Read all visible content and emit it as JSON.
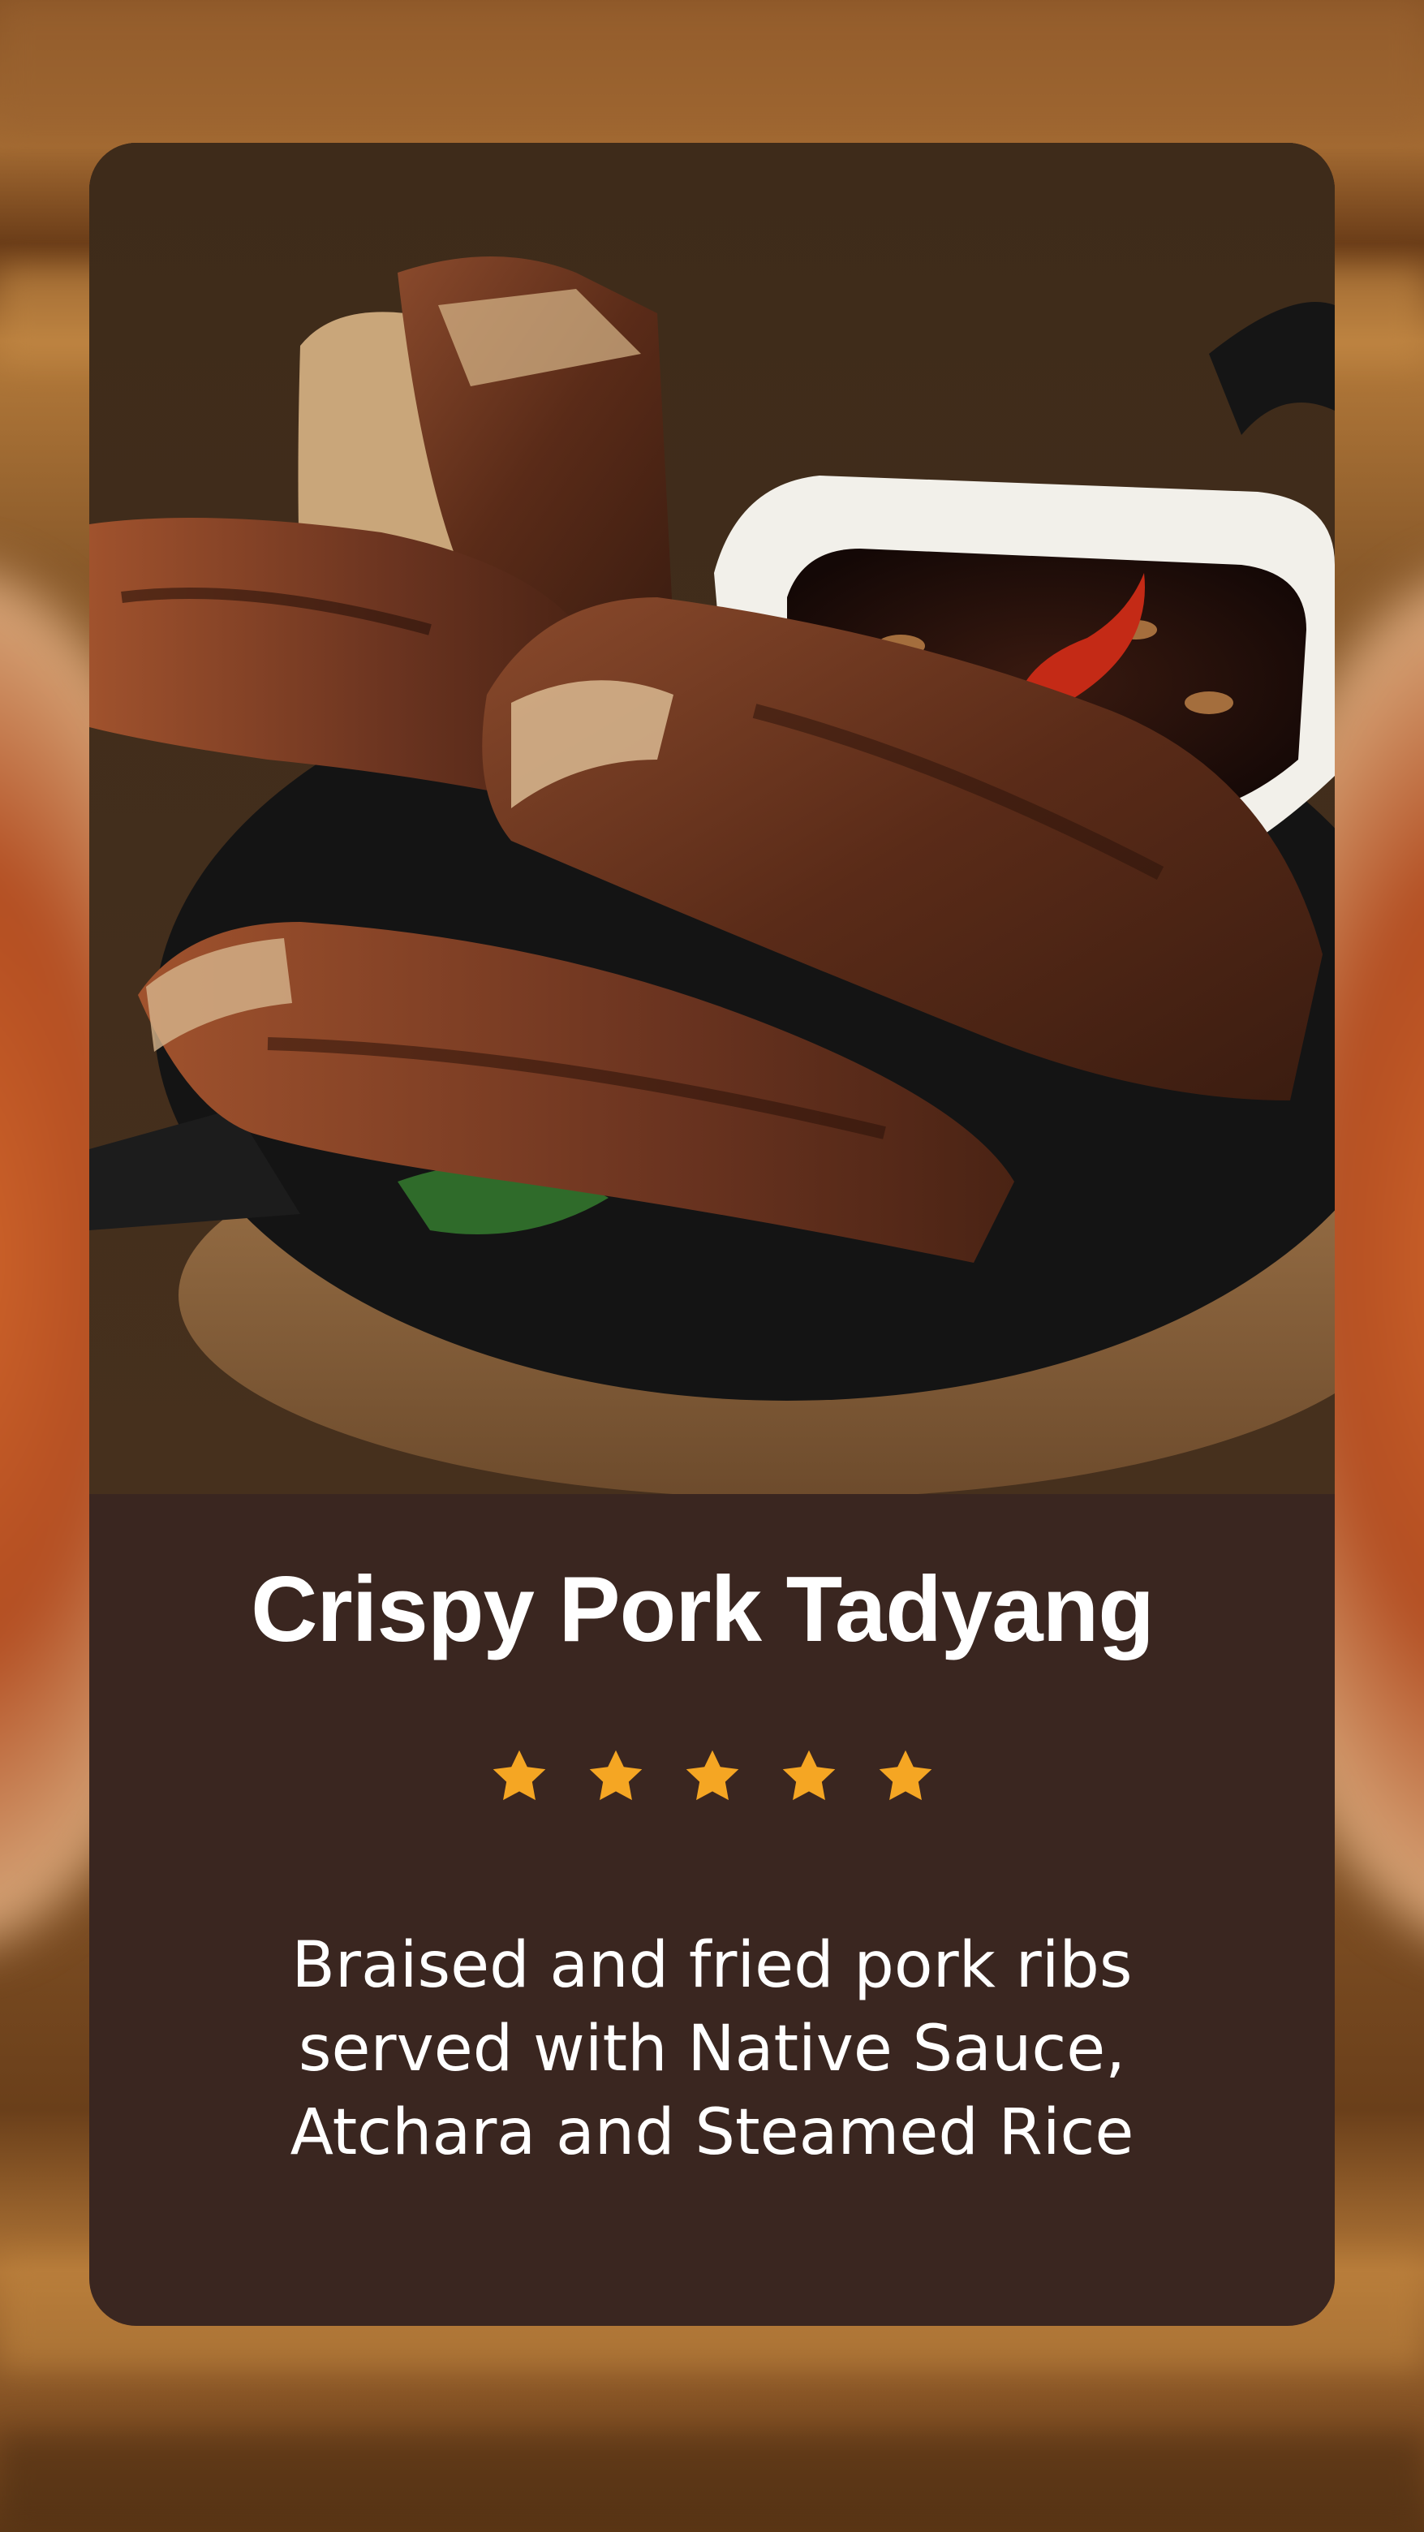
{
  "menu_item": {
    "name": "Crispy Pork Tadyang",
    "rating": {
      "value": 5,
      "max": 5,
      "star_color": "#f5a623"
    },
    "description": "Braised and fried pork ribs served with Native Sauce, Atchara and Steamed Rice"
  },
  "colors": {
    "card_background": "#3a2620",
    "text": "#ffffff",
    "backdrop_wood": "#8a5527"
  },
  "icons": {
    "star": "star-icon"
  }
}
